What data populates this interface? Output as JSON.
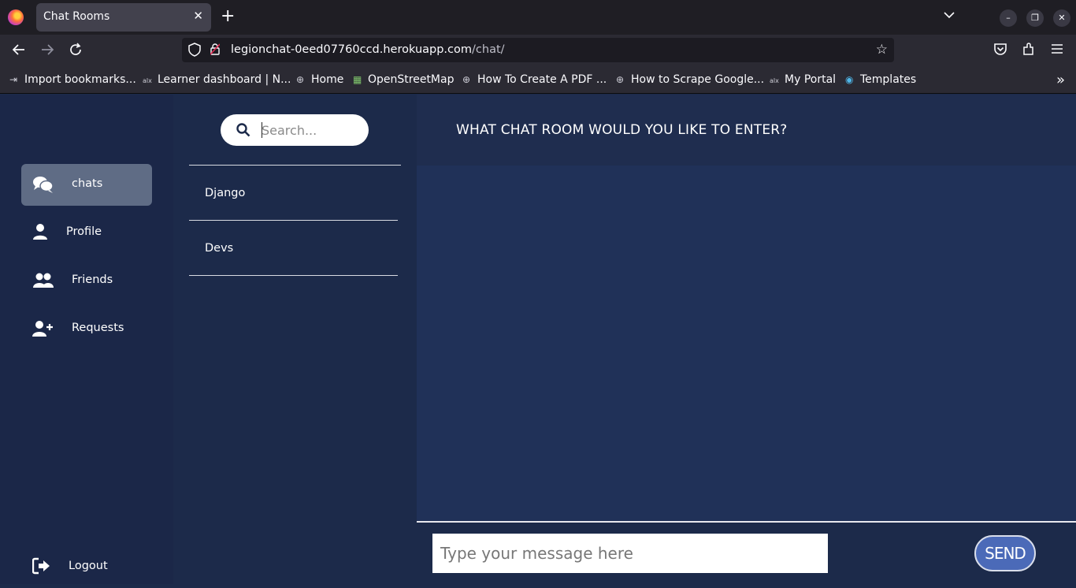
{
  "browser": {
    "tab_title": "Chat Rooms",
    "url_host": "legionchat-0eed07760ccd.herokuapp.com",
    "url_path": "/chat/",
    "bookmarks": [
      {
        "label": "Import bookmarks...",
        "icon": "import-icon"
      },
      {
        "label": "Learner dashboard | N...",
        "icon": "alx-icon"
      },
      {
        "label": "Home",
        "icon": "globe-icon"
      },
      {
        "label": "OpenStreetMap",
        "icon": "map-icon"
      },
      {
        "label": "How To Create A PDF ...",
        "icon": "globe-icon"
      },
      {
        "label": "How to Scrape Google...",
        "icon": "globe-icon"
      },
      {
        "label": "My Portal",
        "icon": "alx-icon"
      },
      {
        "label": "Templates",
        "icon": "canva-icon"
      }
    ]
  },
  "sidebar": {
    "items": [
      {
        "label": "chats",
        "icon": "chats-icon",
        "active": true
      },
      {
        "label": "Profile",
        "icon": "user-icon"
      },
      {
        "label": "Friends",
        "icon": "friends-icon"
      },
      {
        "label": "Requests",
        "icon": "user-plus-icon"
      }
    ],
    "logout_label": "Logout"
  },
  "rooms": {
    "search_placeholder": "Search...",
    "items": [
      "Django",
      "Devs"
    ]
  },
  "chat": {
    "title": "WHAT CHAT ROOM WOULD YOU LIKE TO ENTER?",
    "message_placeholder": "Type your message here",
    "send_label": "SEND"
  },
  "colors": {
    "page_bg": "#1c2a4a",
    "chat_area_bg": "#203158",
    "active_item_bg": "#5f6c85",
    "send_button_bg": "#4b6ab8"
  }
}
